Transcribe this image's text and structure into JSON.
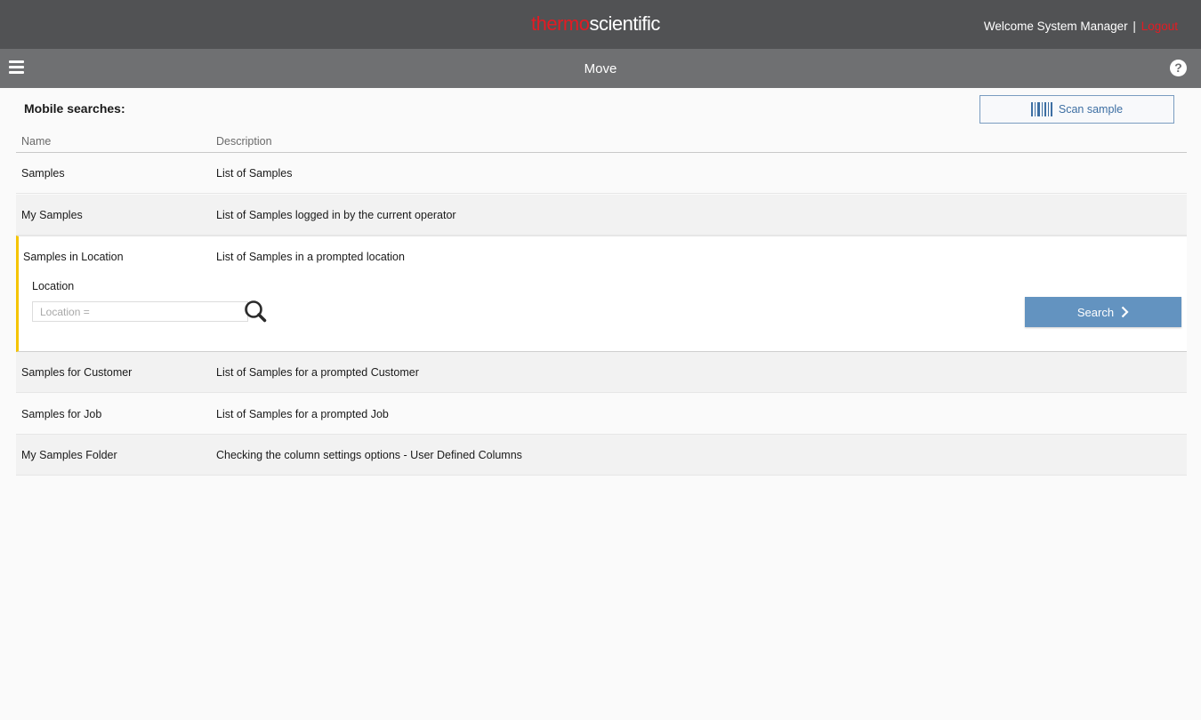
{
  "header": {
    "logo_part1": "thermo",
    "logo_part2": "scientific",
    "welcome": "Welcome System Manager",
    "separator": "|",
    "logout": "Logout"
  },
  "toolbar": {
    "title": "Move",
    "help": "?"
  },
  "main": {
    "section_title": "Mobile searches:",
    "scan_label": "Scan sample",
    "columns": {
      "name": "Name",
      "description": "Description"
    },
    "rows": [
      {
        "name": "Samples",
        "description": "List of Samples"
      },
      {
        "name": "My Samples",
        "description": "List of Samples logged in by the current operator"
      },
      {
        "name": "Samples in Location",
        "description": "List of Samples in a prompted location"
      },
      {
        "name": "Samples for Customer",
        "description": "List of Samples for a prompted Customer"
      },
      {
        "name": "Samples for Job",
        "description": "List of Samples for a prompted Job"
      },
      {
        "name": "My Samples Folder",
        "description": "Checking the column settings options - User Defined Columns"
      }
    ],
    "location": {
      "label": "Location",
      "placeholder": "Location =",
      "value": ""
    },
    "search_label": "Search"
  },
  "colors": {
    "topbar": "#515254",
    "subbar": "#6f7072",
    "brand_red": "#e31b23",
    "selected_accent": "#f5c400",
    "primary_button": "#6393c0"
  },
  "icons": [
    "menu-icon",
    "help-icon",
    "barcode-icon",
    "search-icon",
    "chevron-right-icon"
  ]
}
